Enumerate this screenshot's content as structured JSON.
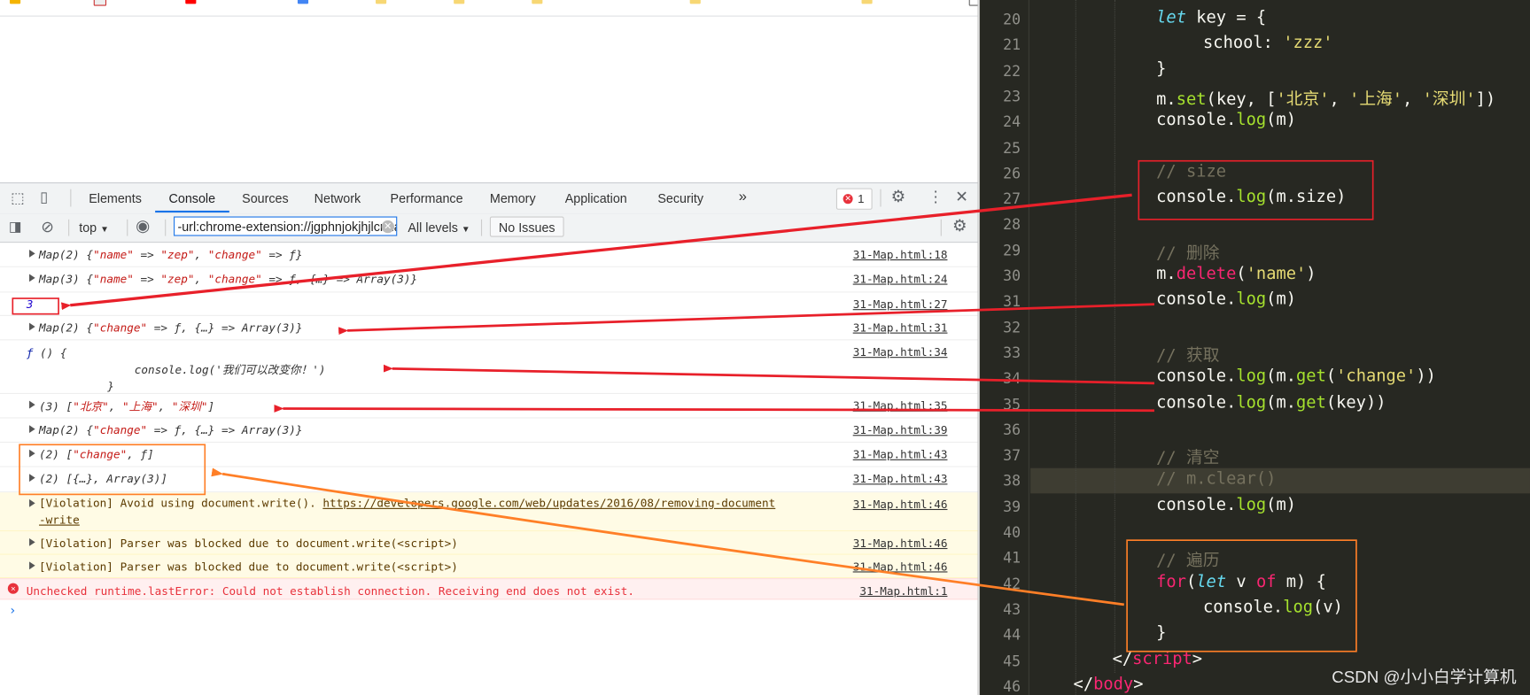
{
  "devtools": {
    "tabs": [
      "Elements",
      "Console",
      "Sources",
      "Network",
      "Performance",
      "Memory",
      "Application",
      "Security"
    ],
    "active_tab": "Console",
    "more_tabs": "»",
    "error_count": "1",
    "context": "top",
    "filter_value": "-url:chrome-extension://jgphnjokjhjlcnnajmfjlacjnjkhleah",
    "levels": "All levels",
    "issues": "No Issues"
  },
  "console": {
    "rows": [
      {
        "type": "log",
        "expand": true,
        "parts": [
          [
            "Map(2) {",
            ""
          ],
          [
            "\"name\"",
            "s"
          ],
          [
            " => ",
            ""
          ],
          [
            "\"zep\"",
            "s"
          ],
          [
            ", ",
            ""
          ],
          [
            "\"change\"",
            "s"
          ],
          [
            " => ƒ}",
            ""
          ]
        ],
        "src": "31-Map.html:18"
      },
      {
        "type": "log",
        "expand": true,
        "parts": [
          [
            "Map(3) {",
            ""
          ],
          [
            "\"name\"",
            "s"
          ],
          [
            " => ",
            ""
          ],
          [
            "\"zep\"",
            "s"
          ],
          [
            ", ",
            ""
          ],
          [
            "\"change\"",
            "s"
          ],
          [
            " => ƒ, {…} => Array(3)}",
            ""
          ]
        ],
        "src": "31-Map.html:24"
      },
      {
        "type": "log",
        "expand": false,
        "parts": [
          [
            "3",
            "n"
          ]
        ],
        "src": "31-Map.html:27"
      },
      {
        "type": "log",
        "expand": true,
        "parts": [
          [
            "Map(2) {",
            ""
          ],
          [
            "\"change\"",
            "s"
          ],
          [
            " => ƒ, {…} => Array(3)}",
            ""
          ]
        ],
        "src": "31-Map.html:31"
      },
      {
        "type": "log",
        "expand": false,
        "parts": [
          [
            "ƒ",
            "k"
          ],
          [
            " () {\n                console.log('我们可以改变你！')\n            }",
            ""
          ]
        ],
        "src": "31-Map.html:34"
      },
      {
        "type": "log",
        "expand": true,
        "parts": [
          [
            "(3) [",
            ""
          ],
          [
            "\"北京\"",
            "s"
          ],
          [
            ", ",
            ""
          ],
          [
            "\"上海\"",
            "s"
          ],
          [
            ", ",
            ""
          ],
          [
            "\"深圳\"",
            "s"
          ],
          [
            "]",
            ""
          ]
        ],
        "src": "31-Map.html:35"
      },
      {
        "type": "log",
        "expand": true,
        "parts": [
          [
            "Map(2) {",
            ""
          ],
          [
            "\"change\"",
            "s"
          ],
          [
            " => ƒ, {…} => Array(3)}",
            ""
          ]
        ],
        "src": "31-Map.html:39"
      },
      {
        "type": "log",
        "expand": true,
        "parts": [
          [
            "(2) [",
            ""
          ],
          [
            "\"change\"",
            "s"
          ],
          [
            ", ƒ]",
            ""
          ]
        ],
        "src": "31-Map.html:43"
      },
      {
        "type": "log",
        "expand": true,
        "parts": [
          [
            "(2) [{…}, Array(3)]",
            ""
          ]
        ],
        "src": "31-Map.html:43"
      },
      {
        "type": "warn",
        "expand": true,
        "parts": [
          [
            "[Violation] Avoid using document.write(). ",
            ""
          ],
          [
            "https://developers.google.com/web/updates/2016/08/removing-document\n-write",
            "u"
          ]
        ],
        "src": "31-Map.html:46"
      },
      {
        "type": "warn",
        "expand": true,
        "parts": [
          [
            "[Violation] Parser was blocked due to document.write(<script>)",
            ""
          ]
        ],
        "src": "31-Map.html:46"
      },
      {
        "type": "warn",
        "expand": true,
        "parts": [
          [
            "[Violation] Parser was blocked due to document.write(<script>)",
            ""
          ]
        ],
        "src": "31-Map.html:46"
      },
      {
        "type": "error",
        "expand": false,
        "parts": [
          [
            "Unchecked runtime.lastError: Could not establish connection. Receiving end does not exist.",
            ""
          ]
        ],
        "src": "31-Map.html:1"
      }
    ],
    "prompt": "›"
  },
  "editor": {
    "lines": [
      {
        "n": "20",
        "indent": 3,
        "tokens": [
          [
            "let",
            "kw"
          ],
          [
            " key = {",
            ""
          ]
        ]
      },
      {
        "n": "21",
        "indent": 4,
        "tokens": [
          [
            "school: ",
            ""
          ],
          [
            "'zzz'",
            "str"
          ]
        ]
      },
      {
        "n": "22",
        "indent": 3,
        "tokens": [
          [
            "}",
            ""
          ]
        ]
      },
      {
        "n": "23",
        "indent": 3,
        "tokens": [
          [
            "m.",
            ""
          ],
          [
            "set",
            "fn"
          ],
          [
            "(key, [",
            ""
          ],
          [
            "'北京'",
            "str"
          ],
          [
            ", ",
            ""
          ],
          [
            "'上海'",
            "str"
          ],
          [
            ", ",
            ""
          ],
          [
            "'深圳'",
            "str"
          ],
          [
            "])",
            ""
          ]
        ]
      },
      {
        "n": "24",
        "indent": 3,
        "tokens": [
          [
            "console.",
            ""
          ],
          [
            "log",
            "fn"
          ],
          [
            "(m)",
            ""
          ]
        ]
      },
      {
        "n": "25",
        "indent": 3,
        "tokens": []
      },
      {
        "n": "26",
        "indent": 3,
        "tokens": [
          [
            "// size",
            "cm"
          ]
        ]
      },
      {
        "n": "27",
        "indent": 3,
        "tokens": [
          [
            "console.",
            ""
          ],
          [
            "log",
            "fn"
          ],
          [
            "(m.size)",
            ""
          ]
        ]
      },
      {
        "n": "28",
        "indent": 3,
        "tokens": []
      },
      {
        "n": "29",
        "indent": 3,
        "tokens": [
          [
            "// 删除",
            "cm"
          ]
        ]
      },
      {
        "n": "30",
        "indent": 3,
        "tokens": [
          [
            "m.",
            ""
          ],
          [
            "delete",
            "red"
          ],
          [
            "(",
            ""
          ],
          [
            "'name'",
            "str"
          ],
          [
            ")",
            ""
          ]
        ]
      },
      {
        "n": "31",
        "indent": 3,
        "tokens": [
          [
            "console.",
            ""
          ],
          [
            "log",
            "fn"
          ],
          [
            "(m)",
            ""
          ]
        ]
      },
      {
        "n": "32",
        "indent": 3,
        "tokens": []
      },
      {
        "n": "33",
        "indent": 3,
        "tokens": [
          [
            "// 获取",
            "cm"
          ]
        ]
      },
      {
        "n": "34",
        "indent": 3,
        "tokens": [
          [
            "console.",
            ""
          ],
          [
            "log",
            "fn"
          ],
          [
            "(m.",
            ""
          ],
          [
            "get",
            "fn"
          ],
          [
            "(",
            ""
          ],
          [
            "'change'",
            "str"
          ],
          [
            "))",
            ""
          ]
        ]
      },
      {
        "n": "35",
        "indent": 3,
        "tokens": [
          [
            "console.",
            ""
          ],
          [
            "log",
            "fn"
          ],
          [
            "(m.",
            ""
          ],
          [
            "get",
            "fn"
          ],
          [
            "(key))",
            ""
          ]
        ]
      },
      {
        "n": "36",
        "indent": 3,
        "tokens": []
      },
      {
        "n": "37",
        "indent": 3,
        "tokens": [
          [
            "// 清空",
            "cm"
          ]
        ]
      },
      {
        "n": "38",
        "indent": 3,
        "tokens": [
          [
            "// m.clear()",
            "cm"
          ]
        ]
      },
      {
        "n": "39",
        "indent": 3,
        "tokens": [
          [
            "console.",
            ""
          ],
          [
            "log",
            "fn"
          ],
          [
            "(m)",
            ""
          ]
        ]
      },
      {
        "n": "40",
        "indent": 3,
        "tokens": []
      },
      {
        "n": "41",
        "indent": 3,
        "tokens": [
          [
            "// 遍历",
            "cm"
          ]
        ]
      },
      {
        "n": "42",
        "indent": 3,
        "tokens": [
          [
            "for",
            "red"
          ],
          [
            "(",
            ""
          ],
          [
            "let",
            "kw"
          ],
          [
            " v ",
            ""
          ],
          [
            "of",
            "red"
          ],
          [
            " m) {",
            ""
          ]
        ]
      },
      {
        "n": "43",
        "indent": 4,
        "tokens": [
          [
            "console.",
            ""
          ],
          [
            "log",
            "fn"
          ],
          [
            "(v)",
            ""
          ]
        ]
      },
      {
        "n": "44",
        "indent": 3,
        "tokens": [
          [
            "}",
            ""
          ]
        ]
      },
      {
        "n": "45",
        "indent": 2,
        "tokens": [
          [
            "</",
            ""
          ],
          [
            "script",
            "red"
          ],
          [
            ">",
            ""
          ]
        ]
      },
      {
        "n": "46",
        "indent": 1,
        "tokens": [
          [
            "</",
            ""
          ],
          [
            "body",
            "red"
          ],
          [
            ">",
            ""
          ]
        ]
      }
    ],
    "watermark": "CSDN @小小白学计算机"
  },
  "colors": {
    "annotation_red": "#e8202a",
    "annotation_orange": "#ff7f27",
    "editor_bg": "#272822",
    "accent": "#1a73e8"
  }
}
